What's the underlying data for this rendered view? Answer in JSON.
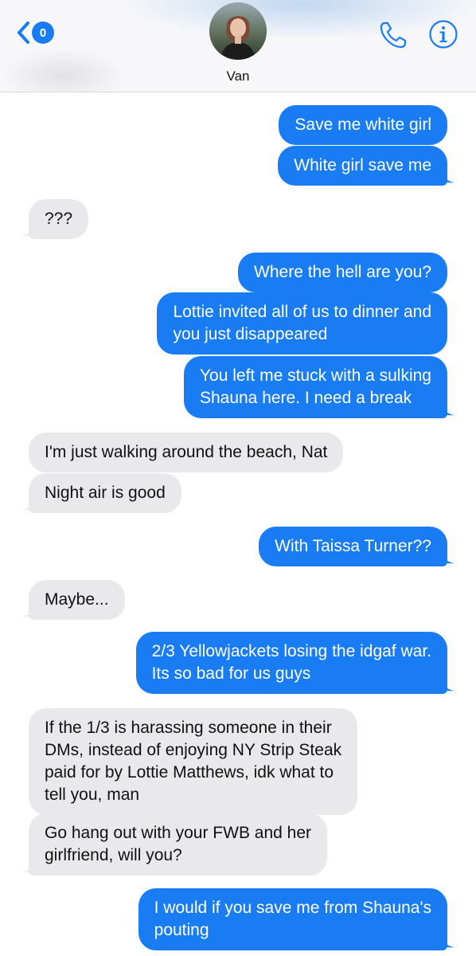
{
  "header": {
    "back_badge": "0",
    "contact_name": "Van",
    "back_icon": "chevron-left-icon",
    "call_icon": "phone-icon",
    "info_icon": "info-icon",
    "accent_color": "#1a7cf2"
  },
  "messages": [
    {
      "from": "me",
      "text": "Save me white girl"
    },
    {
      "from": "me",
      "text": "White girl save me"
    },
    {
      "from": "them",
      "text": "???"
    },
    {
      "from": "me",
      "text": "Where the hell are you?"
    },
    {
      "from": "me",
      "lines": [
        "Lottie invited all of us to dinner and",
        "you just disappeared"
      ]
    },
    {
      "from": "me",
      "lines": [
        "You left me stuck with a sulking",
        "Shauna here. I need a break"
      ]
    },
    {
      "from": "them",
      "text": "I'm just walking around the beach, Nat"
    },
    {
      "from": "them",
      "text": "Night air is good"
    },
    {
      "from": "me",
      "text": "With Taissa Turner??"
    },
    {
      "from": "them",
      "text": "Maybe..."
    },
    {
      "from": "me",
      "lines": [
        "2/3 Yellowjackets losing the idgaf war.",
        "Its so bad for us guys"
      ]
    },
    {
      "from": "them",
      "lines": [
        "If the 1/3 is harassing someone in their",
        "DMs, instead of enjoying NY Strip Steak",
        "paid for by Lottie Matthews, idk what to",
        "tell you, man"
      ]
    },
    {
      "from": "them",
      "lines": [
        "Go hang out with your FWB and her",
        "girlfriend, will you?"
      ]
    },
    {
      "from": "me",
      "lines": [
        "I would if you save me from Shauna's",
        "pouting"
      ]
    }
  ]
}
